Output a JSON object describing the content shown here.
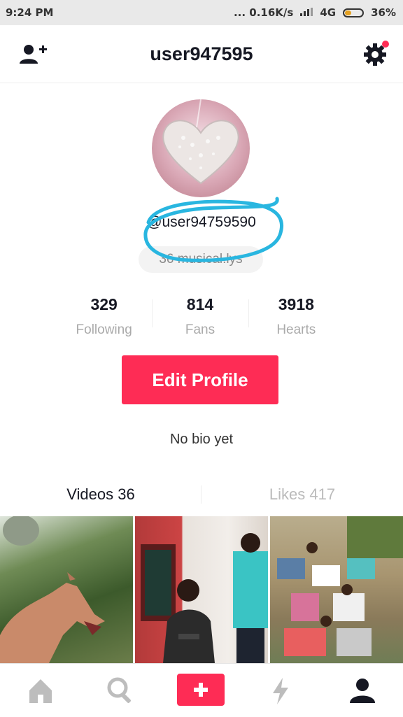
{
  "status": {
    "time": "9:24 PM",
    "speed": "... 0.16K/s",
    "network": "4G",
    "battery": "36%",
    "battery_level": 0.36
  },
  "header": {
    "title": "user947595"
  },
  "profile": {
    "handle": "@user94759590",
    "musically": "36 musical.lys",
    "stats": [
      {
        "value": "329",
        "label": "Following"
      },
      {
        "value": "814",
        "label": "Fans"
      },
      {
        "value": "3918",
        "label": "Hearts"
      }
    ],
    "edit_label": "Edit Profile",
    "bio": "No bio yet"
  },
  "tabs": [
    {
      "label": "Videos 36"
    },
    {
      "label": "Likes 417"
    }
  ],
  "icons": {
    "add_user": "add-user-icon",
    "settings": "gear-icon",
    "home": "home-icon",
    "search": "search-icon",
    "create": "plus-icon",
    "notifications": "lightning-icon",
    "me": "person-icon"
  },
  "colors": {
    "accent": "#fe2c55",
    "annotation": "#29b6e0"
  }
}
